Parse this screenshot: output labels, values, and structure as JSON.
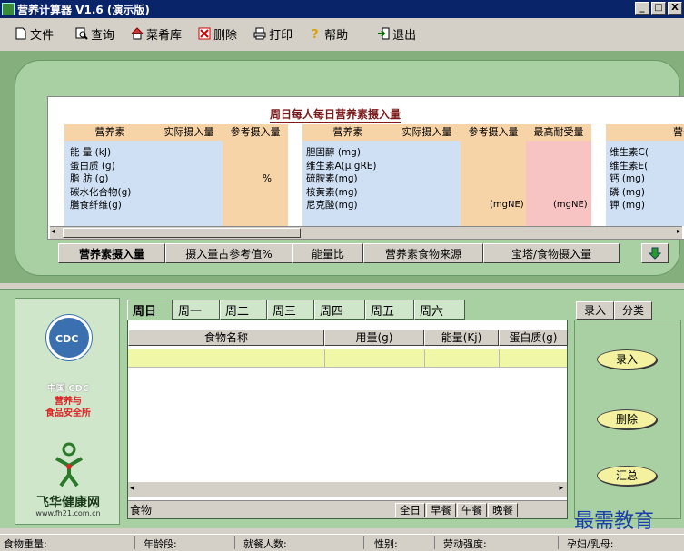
{
  "window": {
    "title": "营养计算器 V1.6 (演示版)",
    "minimize": "_",
    "maximize": "□",
    "close": "X"
  },
  "menu": {
    "file": "文件",
    "query": "查询",
    "recipes": "菜肴库",
    "delete": "删除",
    "print": "打印",
    "help": "帮助",
    "exit": "退出"
  },
  "nutrient_table": {
    "title": "周日每人每日营养素摄入量",
    "group1_headers": [
      "营养素",
      "实际摄入量",
      "参考摄入量"
    ],
    "group1_rows": [
      "能 量 (kJ)",
      "蛋白质 (g)",
      "脂 肪 (g)",
      "碳水化合物(g)",
      "膳食纤维(g)"
    ],
    "group1_unit_symbol": "%",
    "group2_headers": [
      "营养素",
      "实际摄入量",
      "参考摄入量",
      "最高耐受量"
    ],
    "group2_rows": [
      "胆固醇 (mg)",
      "维生素A(μ gRE)",
      "硫胺素(mg)",
      "核黄素(mg)",
      "尼克酸(mg)"
    ],
    "group2_ref_unit": "(mgNE)",
    "group2_max_unit": "(mgNE)",
    "group3_header": "营养",
    "group3_rows": [
      "维生素C(",
      "维生素E(",
      "钙 (mg)",
      "磷 (mg)",
      "钾 (mg)"
    ]
  },
  "bottom_tabs": [
    "营养素摄入量",
    "摄入量占参考值%",
    "能量比",
    "营养素食物来源",
    "宝塔/食物摄入量"
  ],
  "logo": {
    "emblem_text": "CDC",
    "org_line1": "中国 CDC",
    "org_line2": "营养与",
    "org_line3": "食品安全所",
    "brand": "飞华健康网",
    "brand_url": "www.fh21.com.cn"
  },
  "day_tabs": [
    "周日",
    "周一",
    "周二",
    "周三",
    "周四",
    "周五",
    "周六"
  ],
  "food_grid": {
    "headers": [
      "食物名称",
      "用量(g)",
      "能量(Kj)",
      "蛋白质(g)"
    ],
    "meal_label": "食物",
    "meal_buttons": [
      "全日",
      "早餐",
      "午餐",
      "晚餐"
    ]
  },
  "right_panel": {
    "tabs": [
      "录入",
      "分类"
    ],
    "buttons": [
      "录入",
      "删除",
      "汇总"
    ]
  },
  "status_bar": [
    "食物重量:",
    "年龄段:",
    "就餐人数:",
    "性别:",
    "劳动强度:",
    "孕妇/乳母:"
  ],
  "watermark": "最需教育"
}
